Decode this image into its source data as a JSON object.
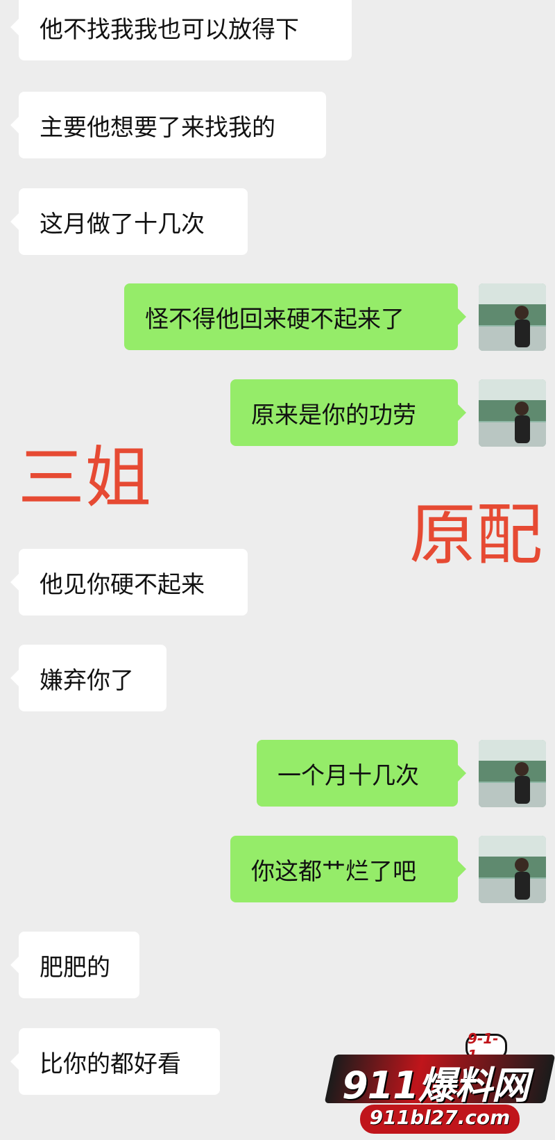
{
  "messages": [
    {
      "side": "left",
      "text": "他不找我我也可以放得下"
    },
    {
      "side": "left",
      "text": "主要他想要了来找我的"
    },
    {
      "side": "left",
      "text": "这月做了十几次"
    },
    {
      "side": "right",
      "text": "怪不得他回来硬不起来了"
    },
    {
      "side": "right",
      "text": "原来是你的功劳"
    },
    {
      "side": "left",
      "text": "他见你硬不起来"
    },
    {
      "side": "left",
      "text": "嫌弃你了"
    },
    {
      "side": "right",
      "text": "一个月十几次"
    },
    {
      "side": "right",
      "text": "你这都艹烂了吧"
    },
    {
      "side": "left",
      "text": "肥肥的"
    },
    {
      "side": "left",
      "text": "比你的都好看"
    }
  ],
  "annotations": {
    "left_label": "三姐",
    "right_label": "原配"
  },
  "watermark": {
    "badge": "9-1-1",
    "title": "911爆料网",
    "url": "911bl27.com"
  },
  "colors": {
    "background": "#ededed",
    "left_bubble": "#ffffff",
    "right_bubble": "#95ec69",
    "annotation": "#e64a33"
  }
}
